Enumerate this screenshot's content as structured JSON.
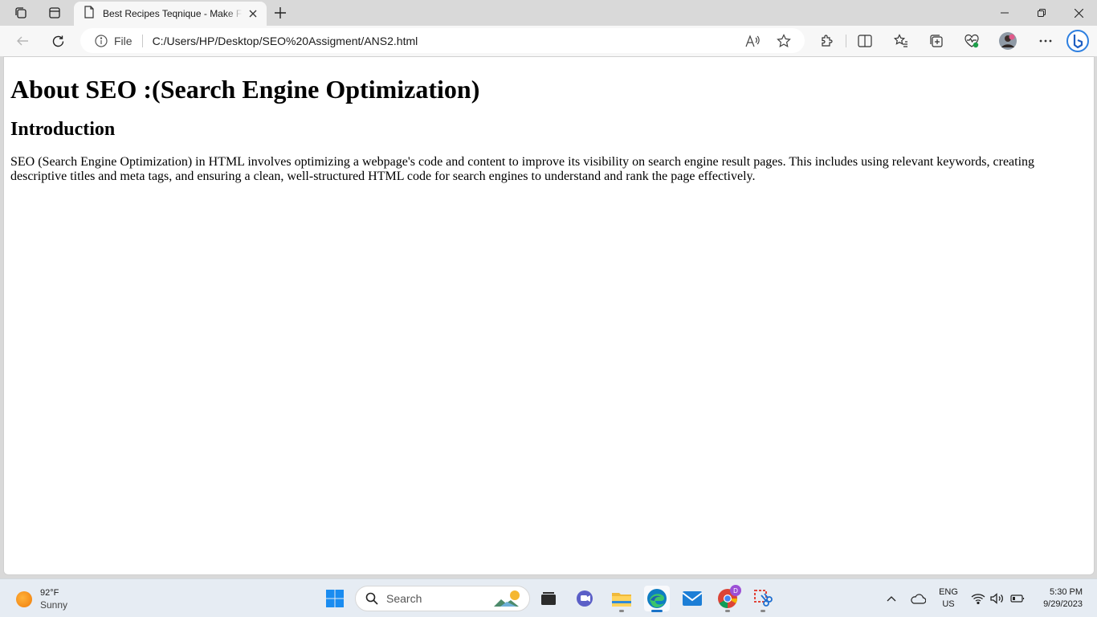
{
  "browser": {
    "tab": {
      "title": "Best Recipes Teqnique - Make Fo"
    },
    "address": {
      "scheme_label": "File",
      "url": "C:/Users/HP/Desktop/SEO%20Assigment/ANS2.html"
    }
  },
  "page": {
    "heading": "About SEO :(Search Engine Optimization)",
    "subheading": "Introduction",
    "paragraph": "SEO (Search Engine Optimization) in HTML involves optimizing a webpage's code and content to improve its visibility on search engine result pages. This includes using relevant keywords, creating descriptive titles and meta tags, and ensuring a clean, well-structured HTML code for search engines to understand and rank the page effectively."
  },
  "taskbar": {
    "weather": {
      "temp": "92°F",
      "condition": "Sunny"
    },
    "search_label": "Search",
    "language": {
      "lang": "ENG",
      "region": "US"
    },
    "clock": {
      "time": "5:30 PM",
      "date": "9/29/2023"
    },
    "chrome_badge": "D"
  },
  "colors": {
    "edge_accent": "#1a73c8",
    "weather_sun": "#f07c0a"
  }
}
